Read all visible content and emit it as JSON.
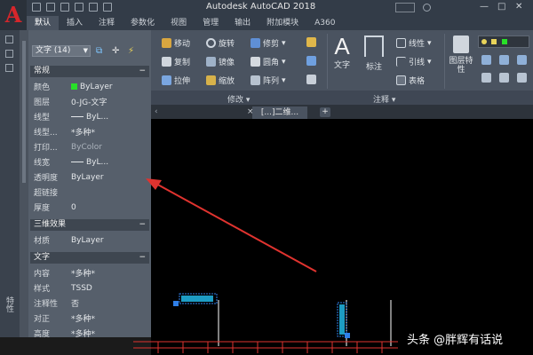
{
  "window": {
    "title": "Autodesk AutoCAD 2018",
    "app_button_glyph": "A",
    "app_button_color": "#d6262b",
    "minimize_glyph": "—",
    "maximize_glyph": "□",
    "close_glyph": "✕"
  },
  "ribbon_tabs": [
    "默认",
    "插入",
    "注释",
    "参数化",
    "视图",
    "管理",
    "输出",
    "附加模块",
    "A360"
  ],
  "ribbon": {
    "modify_buttons": [
      {
        "label": "移动",
        "icon": "move-icon"
      },
      {
        "label": "旋转",
        "icon": "rotate-icon"
      },
      {
        "label": "修剪",
        "icon": "trim-icon"
      },
      {
        "label": "复制",
        "icon": "copy-icon"
      },
      {
        "label": "镜像",
        "icon": "mirror-icon"
      },
      {
        "label": "圆角",
        "icon": "fillet-icon"
      },
      {
        "label": "拉伸",
        "icon": "stretch-icon"
      },
      {
        "label": "缩放",
        "icon": "scale-icon"
      },
      {
        "label": "阵列",
        "icon": "array-icon"
      }
    ],
    "text_button": {
      "glyph": "A",
      "label": "文字"
    },
    "dim_button": {
      "label": "标注"
    },
    "annotation_buttons": [
      {
        "label": "线性",
        "icon": "linear-dim-icon"
      },
      {
        "label": "引线",
        "icon": "leader-icon"
      },
      {
        "label": "表格",
        "icon": "table-icon"
      }
    ],
    "layer_button": {
      "label": "图层特性"
    },
    "panel_labels": {
      "modify": "修改 ▾",
      "annotation": "注释 ▾"
    }
  },
  "palette": {
    "selector": "文字 (14)",
    "sections": {
      "general": "常规",
      "threed": "三维效果",
      "text": "文字"
    },
    "general_rows": [
      {
        "key": "颜色",
        "value": "ByLayer",
        "swatch": "#28e028"
      },
      {
        "key": "图层",
        "value": "0-JG-文字"
      },
      {
        "key": "线型",
        "value": "ByL...",
        "line": true
      },
      {
        "key": "线型...",
        "value": "*多种*"
      },
      {
        "key": "打印...",
        "value": "ByColor",
        "dim": true
      },
      {
        "key": "线宽",
        "value": "ByL...",
        "line": true
      },
      {
        "key": "透明度",
        "value": "ByLayer"
      },
      {
        "key": "超链接",
        "value": ""
      },
      {
        "key": "厚度",
        "value": "0"
      }
    ],
    "threed_rows": [
      {
        "key": "材质",
        "value": "ByLayer"
      }
    ],
    "text_rows": [
      {
        "key": "内容",
        "value": "*多种*"
      },
      {
        "key": "样式",
        "value": "TSSD"
      },
      {
        "key": "注释性",
        "value": "否"
      },
      {
        "key": "对正",
        "value": "*多种*"
      },
      {
        "key": "高度",
        "value": "*多种*"
      }
    ]
  },
  "left_strip_label": "特性",
  "document_tab": {
    "label": "[俯视]二维线框",
    "short": "[...]二维..."
  },
  "watermark": "头条 @胖辉有话说",
  "colors": {
    "accent_red": "#e0332f",
    "cad_cyan": "#22b7e6",
    "highlight_blue": "#2f7fe8",
    "grip_green": "#28e028"
  }
}
